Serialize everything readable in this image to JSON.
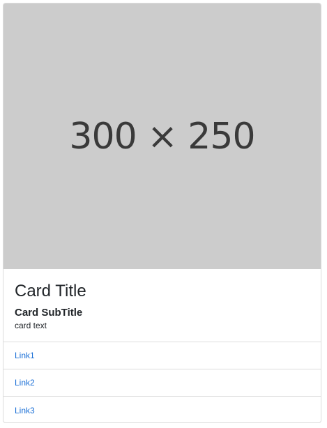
{
  "card": {
    "image_text": "300 × 250",
    "title": "Card Title",
    "subtitle": "Card SubTitle",
    "text": "card text",
    "links": [
      {
        "label": "Link1"
      },
      {
        "label": "Link2"
      },
      {
        "label": "Link3"
      }
    ]
  },
  "colors": {
    "image_placeholder_bg": "#cccccc",
    "link": "#1a6fd6",
    "border": "#dcdcdc"
  }
}
